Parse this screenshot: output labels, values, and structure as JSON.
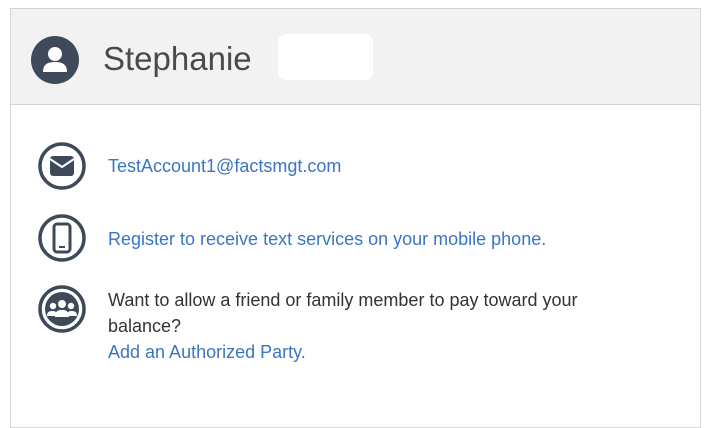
{
  "profile": {
    "name": "Stephanie",
    "email": "TestAccount1@factsmgt.com",
    "sms_link": "Register to receive text services on your mobile phone.",
    "authorized_prompt_line1": "Want to allow a friend or family member to pay toward your",
    "authorized_prompt_line2": "balance?",
    "authorized_link": "Add an Authorized Party."
  },
  "colors": {
    "link": "#3a75c4",
    "icon": "#3e4a59",
    "header_bg": "#f2f2f2"
  },
  "icons": {
    "avatar": "user-avatar-icon",
    "email": "envelope-icon",
    "phone": "mobile-phone-icon",
    "group": "group-people-icon"
  }
}
